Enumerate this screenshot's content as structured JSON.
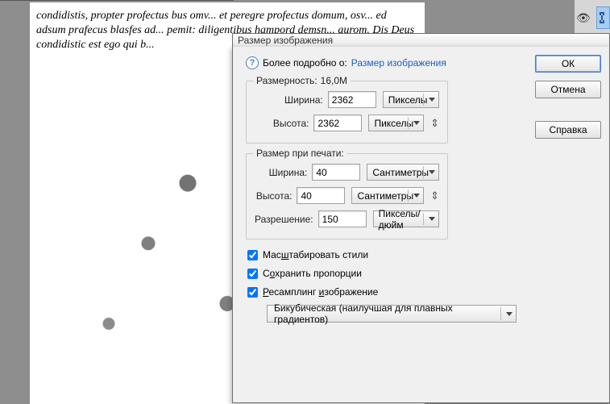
{
  "dialog": {
    "title": "Размер изображения",
    "info_prefix": "Более подробно о:",
    "info_link": "Размер изображения",
    "buttons": {
      "ok": "ОК",
      "cancel": "Отмена",
      "help": "Справка"
    }
  },
  "dimensions": {
    "legend": "Размерность:",
    "size": "16,0M",
    "width_label": "Ширина:",
    "width_value": "2362",
    "width_unit": "Пикселы",
    "height_label": "Высота:",
    "height_value": "2362",
    "height_unit": "Пикселы"
  },
  "print_size": {
    "legend": "Размер при печати:",
    "width_label": "Ширина:",
    "width_value": "40",
    "width_unit": "Сантиметры",
    "height_label": "Высота:",
    "height_value": "40",
    "height_unit": "Сантиметры",
    "resolution_label": "Разрешение:",
    "resolution_value": "150",
    "resolution_unit": "Пикселы/дюйм"
  },
  "options": {
    "scale_styles": "Масштабировать стили",
    "constrain": "Сохранить пропорции",
    "resample": "Ресамплинг изображение",
    "method": "Бикубическая (наилучшая для плавных градиентов)"
  },
  "canvas_text": "condidistis, propter profectus bus omv... et peregre profectus domum, osv... ed adsum prafecus blasfes ad... pemit: diligentibus hampord demsn... aurom.                                                       Dis Deus condidistic est ego qui b..."
}
